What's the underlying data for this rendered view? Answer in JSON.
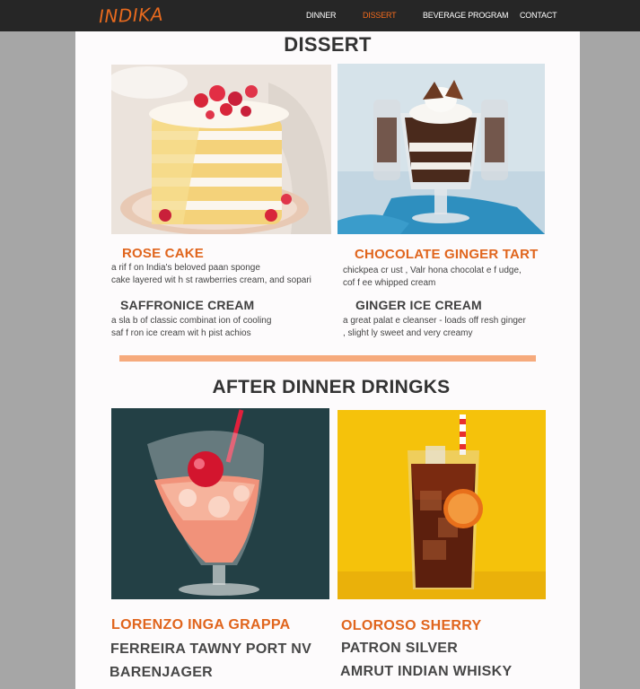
{
  "brand": {
    "logo_text": "INDIKA"
  },
  "nav": {
    "items": [
      {
        "label": "DINNER",
        "active": false
      },
      {
        "label": "DISSERT",
        "active": true
      },
      {
        "label": "BEVERAGE PROGRAM",
        "active": false
      },
      {
        "label": "CONTACT",
        "active": false
      }
    ]
  },
  "dessert": {
    "title": "DISSERT",
    "items": [
      {
        "name": "ROSE  CAKE",
        "desc": [
          "a rif f on India's beloved paan sponge",
          "cake layered wit h st rawberries cream, and sopari"
        ]
      },
      {
        "name": "SAFFRONICE  CREAM",
        "desc": [
          "a sla b of classic combinat ion of cooling",
          "saf f ron ice cream wit h pist achios"
        ]
      },
      {
        "name": "CHOCOLATE GINGER TART",
        "desc": [
          "chickpea cr ust , Valr hona chocolat e f udge,",
          "cof f ee whipped cream"
        ]
      },
      {
        "name": "GINGER  ICE CREAM",
        "desc": [
          "a great palat e  cleanser - loads off resh ginger",
          ", slight ly sweet and very creamy"
        ]
      }
    ]
  },
  "drinks": {
    "title": "AFTER DINNER DRINGKS",
    "left": [
      "LORENZO  INGA GRAPPA",
      "FERREIRA TAWNY PORT NV",
      "BARENJAGER"
    ],
    "right": [
      "OLOROSO  SHERRY",
      "PATRON  SILVER",
      "AMRUT  INDIAN  WHISKY"
    ]
  },
  "colors": {
    "accent": "#e0651d",
    "navbar": "#262626",
    "divider": "#f6aa7c",
    "page_bg": "#a6a6a6"
  }
}
